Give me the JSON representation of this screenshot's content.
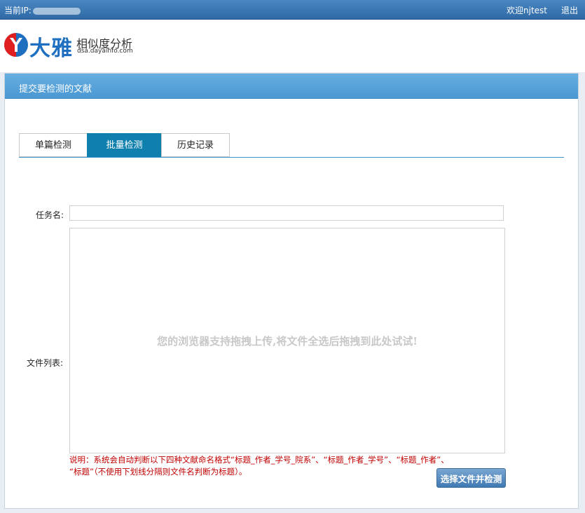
{
  "topbar": {
    "ip_label": "当前IP:",
    "welcome": "欢迎njtest",
    "logout": "退出"
  },
  "brand": {
    "logo_letter": "Y",
    "name": "大雅",
    "subtitle": "相似度分析",
    "url": "dsa.dayainfo.com"
  },
  "panel": {
    "title": "提交要检测的文献"
  },
  "tabs": [
    {
      "label": "单篇检测",
      "active": false
    },
    {
      "label": "批量检测",
      "active": true
    },
    {
      "label": "历史记录",
      "active": false
    }
  ],
  "form": {
    "task_name_label": "任务名:",
    "task_name_value": "",
    "file_list_label": "文件列表:",
    "drop_hint": "您的浏览器支持拖拽上传,将文件全选后拖拽到此处试试!",
    "note_line1": "说明：系统会自动判断以下四种文献命名格式“标题_作者_学号_院系”、“标题_作者_学号”、“标题_作者”、",
    "note_line2": "“标题”（不使用下划线分隔则文件名判断为标题）。",
    "submit_label": "选择文件并检测"
  },
  "colors": {
    "topbar": "#3a78b5",
    "panel_header": "#5aa5da",
    "tab_active": "#0f7fae",
    "note_text": "#c00000",
    "brand_blue": "#1f6fc0",
    "brand_red": "#e02020"
  }
}
